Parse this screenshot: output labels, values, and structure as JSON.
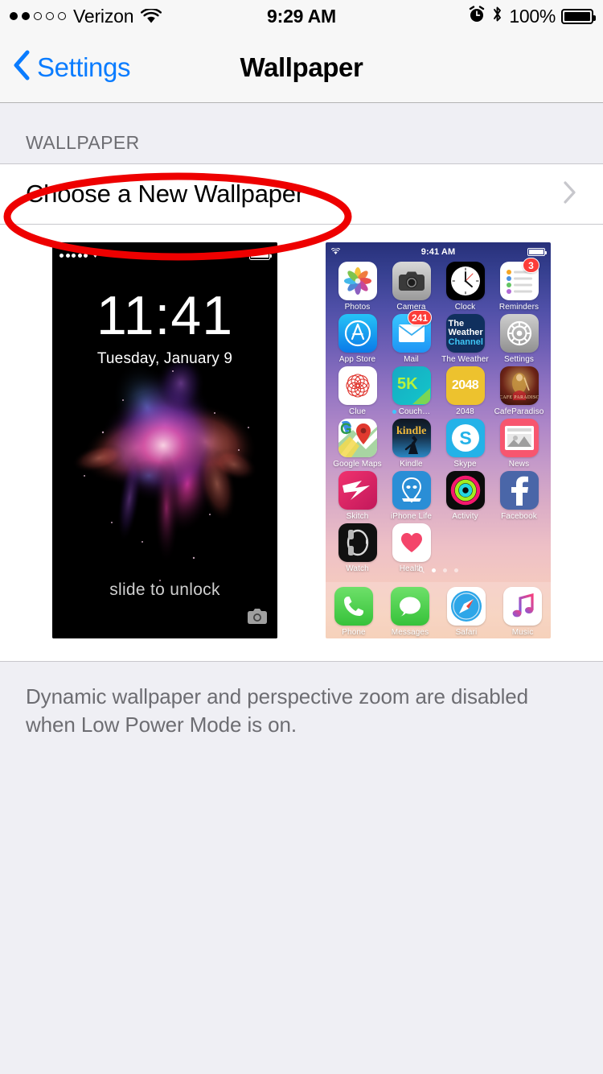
{
  "status_bar": {
    "signal_filled": 2,
    "signal_total": 5,
    "carrier": "Verizon",
    "wifi_icon": "wifi-icon",
    "time": "9:29 AM",
    "alarm_icon": "alarm-clock-icon",
    "bluetooth_icon": "bluetooth-icon",
    "battery_percent": "100%",
    "battery_level": 100
  },
  "nav_bar": {
    "back_label": "Settings",
    "back_icon": "chevron-left-icon",
    "title": "Wallpaper"
  },
  "section": {
    "header": "WALLPAPER",
    "cell_label": "Choose a New Wallpaper",
    "chevron_icon": "chevron-right-icon"
  },
  "lock_preview": {
    "name": "lock-screen-preview",
    "signal_dots": 5,
    "wifi_icon": "wifi-icon",
    "battery_level": 100,
    "time": "11:41",
    "date": "Tuesday, January 9",
    "slide_text": "slide to unlock",
    "camera_icon": "camera-icon"
  },
  "home_preview": {
    "name": "home-screen-preview",
    "wifi_icon": "wifi-icon",
    "time": "9:41 AM",
    "battery_level": 100,
    "apps": [
      {
        "label": "Photos",
        "icon": "photos-icon"
      },
      {
        "label": "Camera",
        "icon": "camera-icon"
      },
      {
        "label": "Clock",
        "icon": "clock-icon"
      },
      {
        "label": "Reminders",
        "icon": "reminders-icon",
        "badge": "3"
      },
      {
        "label": "App Store",
        "icon": "app-store-icon"
      },
      {
        "label": "Mail",
        "icon": "mail-icon",
        "badge": "241"
      },
      {
        "label": "The Weather",
        "icon": "weather-channel-icon"
      },
      {
        "label": "Settings",
        "icon": "settings-icon"
      },
      {
        "label": "Clue",
        "icon": "clue-icon"
      },
      {
        "label": "Couch…",
        "icon": "couch-to-5k-icon",
        "new": true
      },
      {
        "label": "2048",
        "icon": "2048-icon"
      },
      {
        "label": "CafeParadiso",
        "icon": "cafe-paradiso-icon"
      },
      {
        "label": "Google Maps",
        "icon": "google-maps-icon"
      },
      {
        "label": "Kindle",
        "icon": "kindle-icon"
      },
      {
        "label": "Skype",
        "icon": "skype-icon"
      },
      {
        "label": "News",
        "icon": "news-icon"
      },
      {
        "label": "Skitch",
        "icon": "skitch-icon"
      },
      {
        "label": "iPhone Life",
        "icon": "iphone-life-icon"
      },
      {
        "label": "Activity",
        "icon": "activity-icon"
      },
      {
        "label": "Facebook",
        "icon": "facebook-icon"
      },
      {
        "label": "Watch",
        "icon": "watch-icon"
      },
      {
        "label": "Health",
        "icon": "health-icon"
      }
    ],
    "page_dots": {
      "search_icon": "search-icon",
      "count": 3,
      "active": 1
    },
    "dock": [
      {
        "label": "Phone",
        "icon": "phone-icon"
      },
      {
        "label": "Messages",
        "icon": "messages-icon"
      },
      {
        "label": "Safari",
        "icon": "safari-icon"
      },
      {
        "label": "Music",
        "icon": "music-icon"
      }
    ]
  },
  "footer": {
    "text": "Dynamic wallpaper and perspective zoom are disabled when Low Power Mode is on."
  },
  "annotation": {
    "shape": "red-ellipse-highlight",
    "color": "#ee0000",
    "target": "Choose a New Wallpaper"
  }
}
